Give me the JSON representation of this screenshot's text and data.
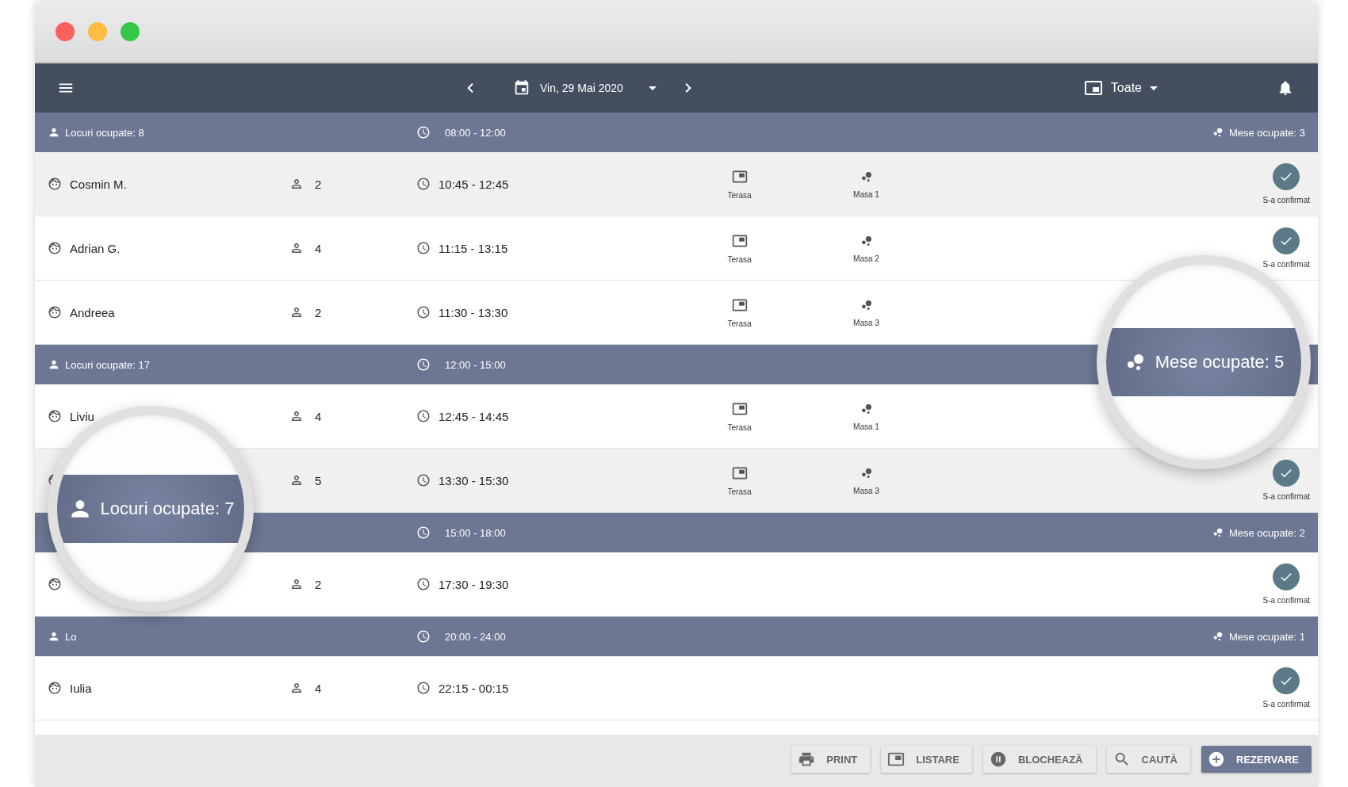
{
  "toolbar": {
    "date": "Vin, 29 Mai 2020",
    "filter": "Toate"
  },
  "groups": [
    {
      "seats": "Locuri ocupate: 8",
      "time": "08:00 - 12:00",
      "tables": "Mese ocupate: 3",
      "reservations": [
        {
          "name": "Cosmin M.",
          "guests": "2",
          "time": "10:45 - 12:45",
          "area": "Terasa",
          "table": "Masa 1",
          "status": "S-a confirmat",
          "confirmed": true,
          "shaded": true
        },
        {
          "name": "Adrian G.",
          "guests": "4",
          "time": "11:15 - 13:15",
          "area": "Terasa",
          "table": "Masa 2",
          "status": "S-a confirmat",
          "confirmed": true,
          "shaded": false
        },
        {
          "name": "Andreea",
          "guests": "2",
          "time": "11:30 - 13:30",
          "area": "Terasa",
          "table": "Masa 3",
          "shaded": false
        }
      ]
    },
    {
      "seats": "Locuri ocupate: 17",
      "time": "12:00 - 15:00",
      "reservations": [
        {
          "name": "Liviu",
          "guests": "4",
          "time": "12:45 - 14:45",
          "area": "Terasa",
          "table": "Masa 1",
          "shaded": false
        },
        {
          "guests": "5",
          "time": "13:30 - 15:30",
          "area": "Terasa",
          "table": "Masa 3",
          "status": "S-a confirmat",
          "confirmed": true,
          "shaded": true
        }
      ]
    },
    {
      "time": "15:00 - 18:00",
      "tables": "Mese ocupate: 2",
      "reservations": [
        {
          "guests": "2",
          "time": "17:30 - 19:30",
          "status": "S-a confirmat",
          "confirmed": true,
          "shaded": false
        }
      ]
    },
    {
      "seats": "Lo",
      "time": "20:00 - 24:00",
      "tables": "Mese ocupate: 1",
      "reservations": [
        {
          "name": "Iulia",
          "guests": "4",
          "time": "22:15 - 00:15",
          "status": "S-a confirmat",
          "confirmed": true,
          "shaded": false
        }
      ]
    }
  ],
  "magnifiers": [
    {
      "kind": "tables",
      "text": "Mese ocupate: 5"
    },
    {
      "kind": "seats",
      "text": "Locuri ocupate: 7"
    }
  ],
  "actions": [
    {
      "kind": "print",
      "label": "PRINT",
      "primary": false
    },
    {
      "kind": "list",
      "label": "LISTARE",
      "primary": false
    },
    {
      "kind": "block",
      "label": "BLOCHEAZĂ",
      "primary": false
    },
    {
      "kind": "search",
      "label": "CAUTĂ",
      "primary": false
    },
    {
      "kind": "add",
      "label": "REZERVARE",
      "primary": true
    }
  ]
}
